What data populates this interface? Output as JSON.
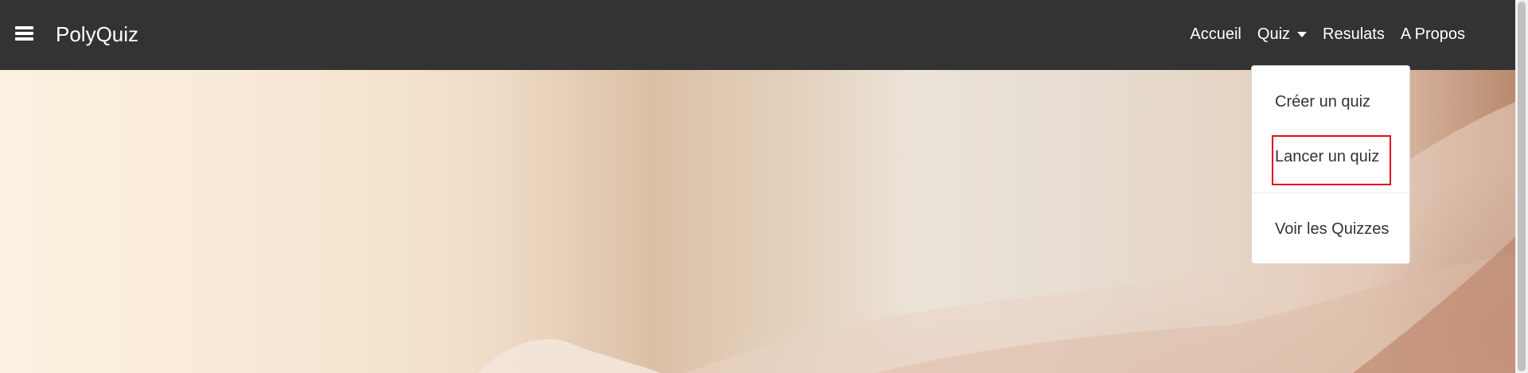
{
  "navbar": {
    "menu_icon": "hamburger-menu-icon",
    "brand": "PolyQuiz",
    "links": [
      {
        "label": "Accueil"
      },
      {
        "label": "Quiz",
        "has_dropdown": true
      },
      {
        "label": "Resulats"
      },
      {
        "label": "A Propos"
      }
    ],
    "background_color": "#333333"
  },
  "quiz_dropdown": {
    "items": [
      {
        "label": "Créer un quiz"
      },
      {
        "label": "Lancer un quiz",
        "highlighted": true
      },
      {
        "label": "Voir les Quizzes"
      }
    ],
    "highlight_color": "#e0101c"
  }
}
